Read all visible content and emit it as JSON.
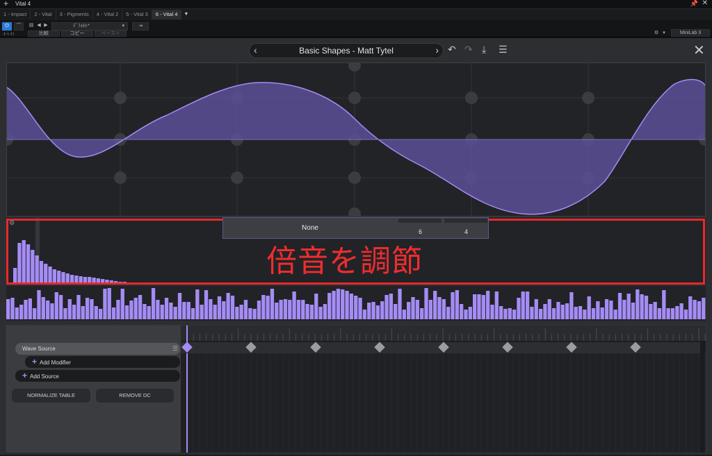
{
  "host": {
    "window_title": "Vital 4",
    "tabs": [
      {
        "label": "1 - Impact",
        "active": false
      },
      {
        "label": "2 - Vital",
        "active": false
      },
      {
        "label": "3 - Pigments",
        "active": false
      },
      {
        "label": "4 - Vital 2",
        "active": false
      },
      {
        "label": "5 - Vital 3",
        "active": false
      },
      {
        "label": "6 - Vital 4",
        "active": true
      }
    ],
    "toolbar": {
      "preset_dropdown": "ﾃﾞﾌｫﾙﾄ*",
      "compare": "比較",
      "copy": "コピー",
      "paste": "ペースト",
      "auto_off": "ｵｰﾄ ｵﾌ",
      "device": "MiniLab 3"
    }
  },
  "plugin": {
    "preset_name": "Basic Shapes  -  Matt Tytel",
    "harmonic_popup": {
      "label": "None",
      "values": [
        "6",
        "4"
      ]
    },
    "annotation": "倍音を調節",
    "sources": {
      "wave_source": "Wave Source",
      "add_modifier": "Add Modifier",
      "add_source": "Add Source"
    },
    "buttons": {
      "normalize": "NORMALIZE TABLE",
      "remove_dc": "REMOVE DC"
    }
  },
  "colors": {
    "accent": "#a58cf5",
    "wave_fill": "#6b5fa8",
    "annotation": "#e8282d"
  },
  "icons": [
    "plus-icon",
    "pin-icon",
    "close-icon",
    "power-icon",
    "save-icon",
    "gear-icon",
    "chevron-left-icon",
    "chevron-right-icon",
    "undo-icon",
    "redo-icon",
    "download-icon",
    "menu-icon",
    "diamond-keyframe-icon"
  ]
}
